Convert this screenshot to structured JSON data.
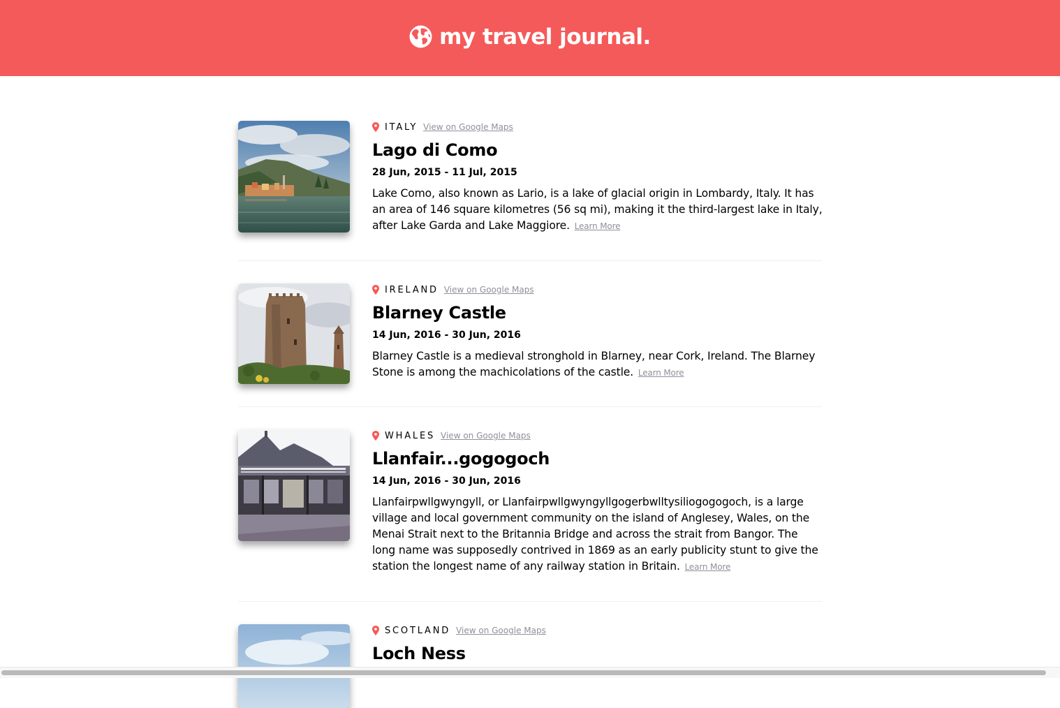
{
  "header": {
    "title": "my travel journal."
  },
  "entries": [
    {
      "country": "ITALY",
      "maps_label": "View on Google Maps",
      "title": "Lago di Como",
      "dates": "28 Jun, 2015 - 11 Jul, 2015",
      "description": "Lake Como, also known as Lario, is a lake of glacial origin in Lombardy, Italy. It has an area of 146 square kilometres (56 sq mi), making it the third-largest lake in Italy, after Lake Garda and Lake Maggiore.",
      "learn_more": "Learn More"
    },
    {
      "country": "IRELAND",
      "maps_label": "View on Google Maps",
      "title": "Blarney Castle",
      "dates": "14 Jun, 2016 - 30 Jun, 2016",
      "description": "Blarney Castle is a medieval stronghold in Blarney, near Cork, Ireland. The Blarney Stone is among the machicolations of the castle.",
      "learn_more": "Learn More"
    },
    {
      "country": "WHALES",
      "maps_label": "View on Google Maps",
      "title": "Llanfair...gogogoch",
      "dates": "14 Jun, 2016 - 30 Jun, 2016",
      "description": "Llanfairpwllgwyngyll, or Llanfairpwllgwyngyllgogerbwlltysiliogogogoch, is a large village and local government community on the island of Anglesey, Wales, on the Menai Strait next to the Britannia Bridge and across the strait from Bangor. The long name was supposedly contrived in 1869 as an early publicity stunt to give the station the longest name of any railway station in Britain.",
      "learn_more": "Learn More"
    },
    {
      "country": "SCOTLAND",
      "maps_label": "View on Google Maps",
      "title": "Loch Ness"
    }
  ],
  "colors": {
    "brand": "#F55A5A",
    "muted_link": "#918E9B",
    "divider": "#F0F0F0"
  },
  "icons": {
    "logo": "globe-icon",
    "location": "map-pin-icon"
  }
}
